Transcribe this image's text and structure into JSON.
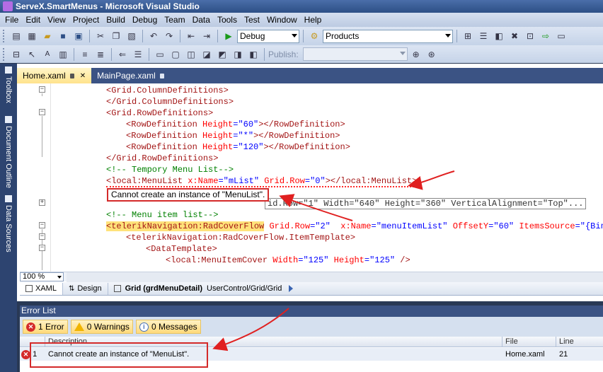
{
  "window": {
    "title": "ServeX.SmartMenus - Microsoft Visual Studio"
  },
  "menu": [
    "File",
    "Edit",
    "View",
    "Project",
    "Build",
    "Debug",
    "Team",
    "Data",
    "Tools",
    "Test",
    "Window",
    "Help"
  ],
  "toolbar": {
    "config_value": "Debug",
    "project_value": "Products",
    "publish_label": "Publish:"
  },
  "sidebar": {
    "toolbox": "Toolbox",
    "document_outline": "Document Outline",
    "data_sources": "Data Sources"
  },
  "tabs": [
    {
      "label": "Home.xaml"
    },
    {
      "label": "MainPage.xaml"
    }
  ],
  "code": {
    "l1": "<Grid.ColumnDefinitions>",
    "l2": "</Grid.ColumnDefinitions>",
    "l3": "<Grid.RowDefinitions>",
    "l4_open": "<RowDefinition ",
    "l4_attr": "Height",
    "l4_val": "\"60\"",
    "l4_close": "></RowDefinition>",
    "l5_val": "\"*\"",
    "l6_val": "\"120\"",
    "l7": "</Grid.RowDefinitions>",
    "l8": "<!-- Tempory Menu List-->",
    "l9_tag": "<local:MenuList ",
    "l9_attr1": "x:Name",
    "l9_val1": "\"mList\"",
    "l9_attr2": " Grid.Row",
    "l9_val2": "\"0\"",
    "l9_close": "></local:MenuList>",
    "l10_tip": "Cannot create an instance of \"MenuList\".",
    "l10_grid": "id.Row=\"1\" Width=\"640\" Height=\"360\" VerticalAlignment=\"Top\"...",
    "l11": "<!-- Menu item list-->",
    "l12_tag": "telerikNavigation:RadCoverFlow",
    "l12_attr1": " Grid.Row",
    "l12_val1": "\"2\"",
    "l12_attr2": "  x:Name",
    "l12_val2": "\"menuItemList\"",
    "l12_attr3": " OffsetY",
    "l12_val3": "\"60\"",
    "l12_attr4": " ItemsSource",
    "l12_val4": "\"{Bindin",
    "l13": "<telerikNavigation:RadCoverFlow.ItemTemplate>",
    "l14": "<DataTemplate>",
    "l15_tag": "<local:MenuItemCover ",
    "l15_attr1": "Width",
    "l15_val1": "\"125\"",
    "l15_attr2": " Height",
    "l15_val2": "\"125\"",
    "l15_close": " />"
  },
  "editor": {
    "zoom": "100 %"
  },
  "split": {
    "xaml_tab": "XAML",
    "design_tab": "Design",
    "breadcrumb_bold": "Grid (grdMenuDetail)",
    "breadcrumb_path": "UserControl/Grid/Grid"
  },
  "error_list": {
    "title": "Error List",
    "filters": {
      "errors": "1 Error",
      "warnings": "0 Warnings",
      "messages": "0 Messages"
    },
    "columns": {
      "description": "Description",
      "file": "File",
      "line": "Line"
    },
    "rows": [
      {
        "num": "1",
        "description": "Cannot create an instance of \"MenuList\".",
        "file": "Home.xaml",
        "line": "21"
      }
    ]
  },
  "colors": {
    "accent": "#3b5384",
    "error": "#d42a2a",
    "active_tab": "#ffe38c"
  }
}
